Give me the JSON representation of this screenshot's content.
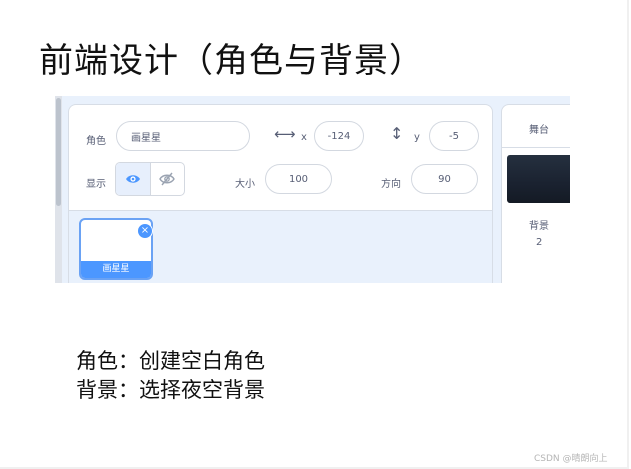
{
  "slide": {
    "title": "前端设计（角色与背景）",
    "lines": [
      "角色：创建空白角色",
      "背景：选择夜空背景"
    ],
    "watermark": "CSDN @晴朗向上"
  },
  "sprite_info": {
    "sprite_label": "角色",
    "sprite_name": "画星星",
    "x_label": "x",
    "x_value": "-124",
    "y_label": "y",
    "y_value": "-5",
    "show_label": "显示",
    "size_label": "大小",
    "size_value": "100",
    "direction_label": "方向",
    "direction_value": "90"
  },
  "sprite_list": {
    "items": [
      {
        "name": "画星星",
        "selected": true
      }
    ],
    "delete_symbol": "×"
  },
  "stage": {
    "header": "舞台",
    "backdrops_label": "背景",
    "backdrops_count": "2"
  },
  "colors": {
    "accent": "#4c97ff",
    "panel_bg": "#e9f1fc",
    "text": "#575e75"
  }
}
